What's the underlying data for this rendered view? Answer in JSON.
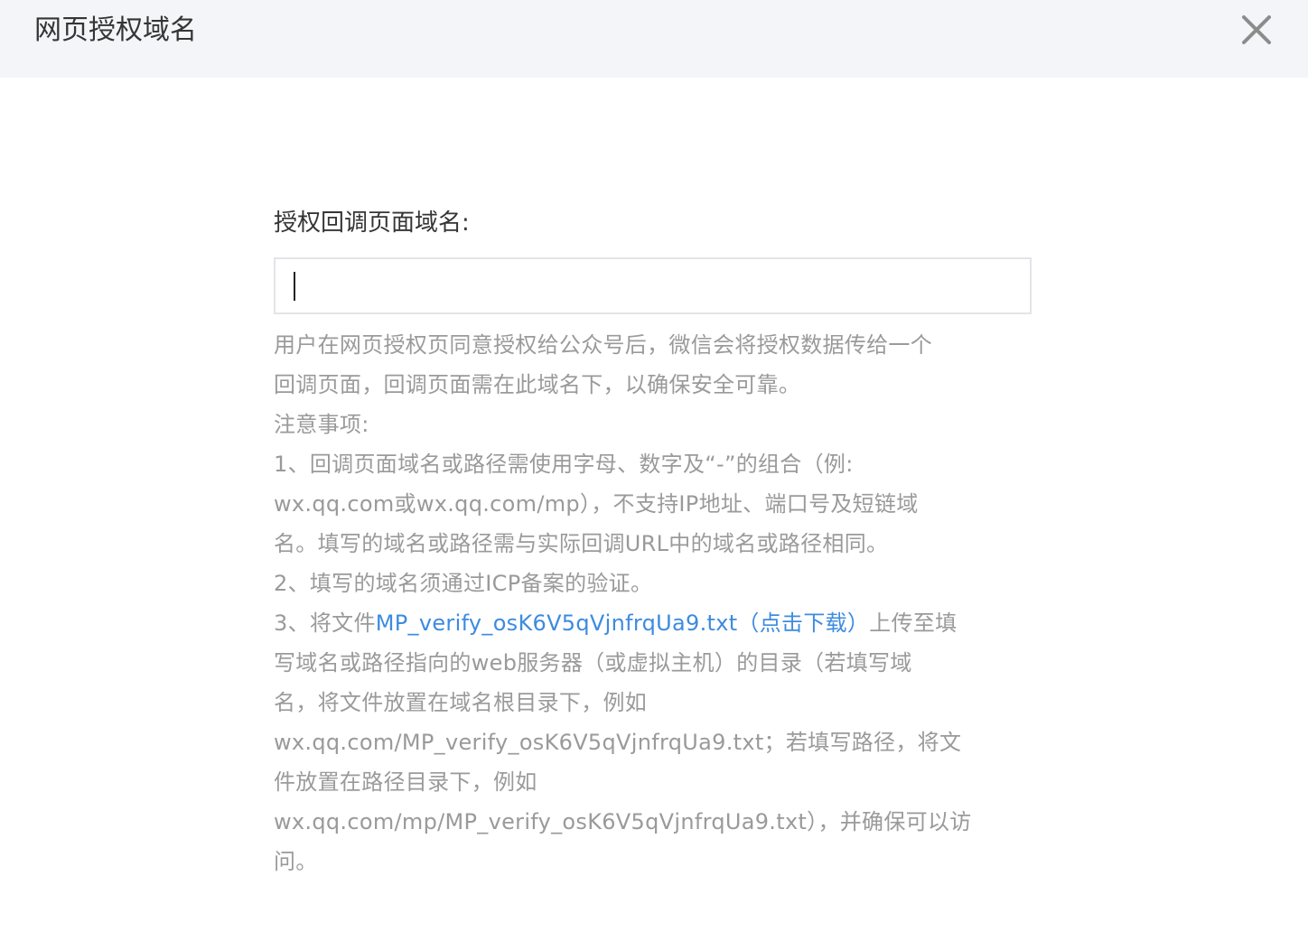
{
  "dialog": {
    "title": "网页授权域名",
    "close_icon": "close-icon"
  },
  "form": {
    "label": "授权回调页面域名:",
    "input_value": "",
    "input_placeholder": ""
  },
  "tips": {
    "lines": [
      "用户在网页授权页同意授权给公众号后，微信会将授权数据传给一个",
      "回调页面，回调页面需在此域名下，以确保安全可靠。",
      "注意事项:",
      "1、回调页面域名或路径需使用字母、数字及“-”的组合（例:",
      "wx.qq.com或wx.qq.com/mp），不支持IP地址、端口号及短链域",
      "名。填写的域名或路径需与实际回调URL中的域名或路径相同。",
      "2、填写的域名须通过ICP备案的验证。"
    ],
    "item3_prefix": "3、将文件",
    "item3_link": "MP_verify_osK6V5qVjnfrqUa9.txt（点击下载）",
    "item3_suffix": "上传至填",
    "more_lines": [
      "写域名或路径指向的web服务器（或虚拟主机）的目录（若填写域",
      "名，将文件放置在域名根目录下，例如",
      "wx.qq.com/MP_verify_osK6V5qVjnfrqUa9.txt；若填写路径，将文",
      "件放置在路径目录下，例如",
      "wx.qq.com/mp/MP_verify_osK6V5qVjnfrqUa9.txt），并确保可以访",
      "问。"
    ]
  },
  "colors": {
    "header_bg": "#f4f5f9",
    "text_dark": "#353535",
    "text_muted": "#9a9a9a",
    "link": "#3d8be0",
    "border": "#e3e4e8"
  }
}
